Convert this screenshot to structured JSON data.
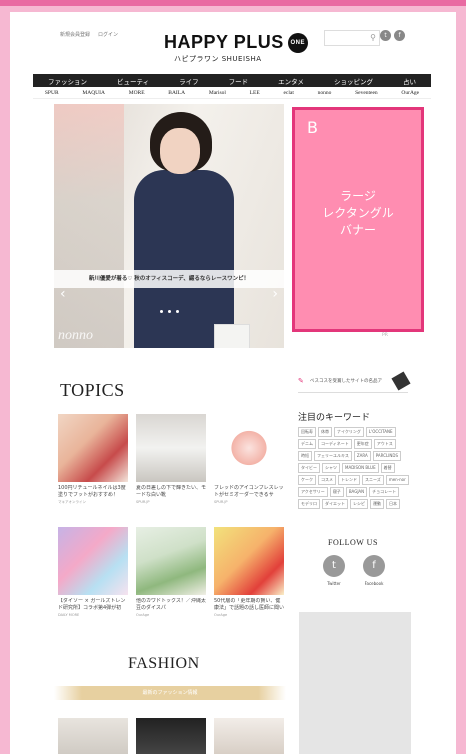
{
  "header": {
    "links": [
      "新規会員登録",
      "ログイン"
    ],
    "logo_main": "HAPPY PLUS",
    "logo_badge": "ONE",
    "logo_sub": "ハピプラワン  SHUEISHA",
    "search_placeholder": ""
  },
  "nav": [
    "ファッション",
    "ビューティ",
    "ライフ",
    "フード",
    "エンタメ",
    "ショッピング",
    "占い"
  ],
  "magazines": [
    "SPUR",
    "MAQUIA",
    "MORE",
    "BAILA",
    "Marisol",
    "LEE",
    "eclat",
    "nonno",
    "Seventeen",
    "OurAge"
  ],
  "hero": {
    "caption": "新川優愛が着る♡ 秋のオフィスコーデ、綴るならレースワンピ！",
    "brand": "nonno",
    "prev_glyph": "‹",
    "next_glyph": "›"
  },
  "banner": {
    "letter": "B",
    "line1": "ラージ",
    "line2": "レクタングル",
    "line3": "バナー"
  },
  "side_sub": "PR",
  "topics": {
    "title": "TOPICS",
    "cards": [
      {
        "text": "100円リチュールネイルは3度塗りでフットがおすすめ！",
        "src": "マキアオンライン"
      },
      {
        "text": "夏の日差しの下で輝きたい、モードな白い靴",
        "src": "SPUR.JP"
      },
      {
        "text": "フレッドのアイコンブレスレットがセミオーダーできるサ",
        "src": "SPUR.JP"
      },
      {
        "text": "【ダイソー × ガールズトレンド研究所】コラボ第4弾が初",
        "src": "DAILY MORE"
      },
      {
        "text": "他のカワドトックス！／沖縄太豆のダイスパ",
        "src": "OurAge"
      },
      {
        "text": "50代層の「更年期の賢い、健康法」で話題の話し医師に聞いてみた",
        "src": "OurAge"
      }
    ]
  },
  "side": {
    "ad_text": "ベスコスを受賞したサイトの名品ア",
    "kw_title": "注目のキーワード",
    "keywords": [
      "回転寿",
      "休帯",
      "ナイクリング",
      "L'OCCITANE",
      "デニム",
      "コーディネート",
      "更年症",
      "アウトス",
      "時短",
      "フェリーユルキス",
      "ZARA",
      "PARCLINDS",
      "タイビー",
      "シャツ",
      "MADISON BLUE",
      "着替",
      "ケーク",
      "コスメ",
      "トレンド",
      "スニーズ",
      "men-nor",
      "アクセサリー",
      "寝子",
      "BAGJAN",
      "チョコレート",
      "モデリロ",
      "ダイエット",
      "レシピ",
      "運動",
      "日本"
    ],
    "follow_title": "FOLLOW US",
    "twitter": "Twitter",
    "facebook": "Facebook"
  },
  "fashion": {
    "title": "FASHION",
    "band": "最新のファッション情報"
  },
  "colors": {
    "pink_bg": "#f6b8d2",
    "banner": "#ff8db1",
    "banner_border": "#e3367a",
    "nav_bg": "#222222"
  }
}
